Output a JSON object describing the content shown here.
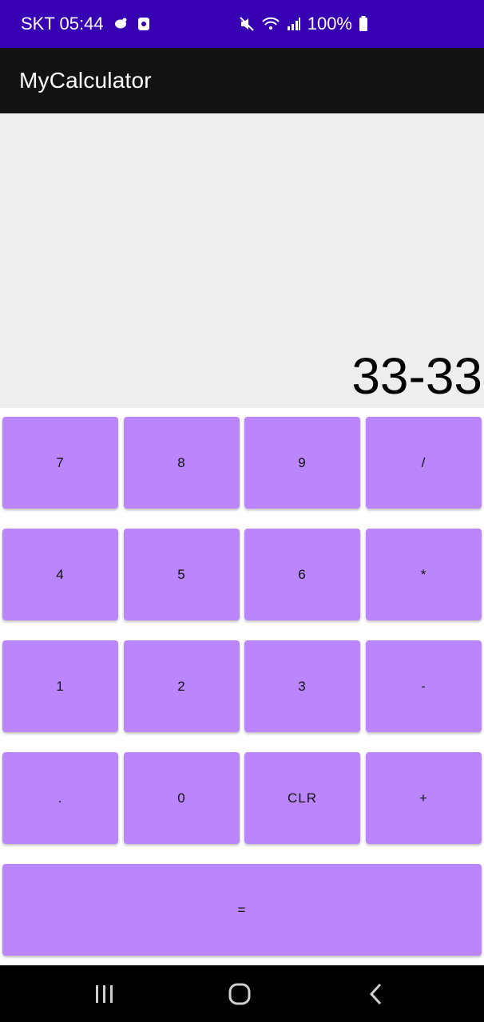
{
  "status_bar": {
    "carrier_time": "SKT 05:44",
    "battery_percent": "100%",
    "icons": [
      "chat-bubble-icon",
      "notification-icon",
      "mute-icon",
      "wifi-icon",
      "signal-icon",
      "battery-icon"
    ]
  },
  "app_bar": {
    "title": "MyCalculator"
  },
  "display": {
    "expression": "33-33"
  },
  "keypad": {
    "rows": [
      [
        "7",
        "8",
        "9",
        "/"
      ],
      [
        "4",
        "5",
        "6",
        "*"
      ],
      [
        "1",
        "2",
        "3",
        "-"
      ],
      [
        ".",
        "0",
        "CLR",
        "+"
      ]
    ],
    "equals": "="
  },
  "colors": {
    "status_bar": "#3700b3",
    "app_bar": "#121212",
    "display_bg": "#eeeeee",
    "key_bg": "#bb86fc"
  },
  "nav_bar": {
    "icons": [
      "recent-apps-icon",
      "home-icon",
      "back-icon"
    ]
  }
}
